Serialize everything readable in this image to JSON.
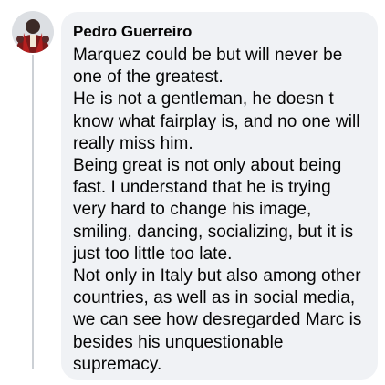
{
  "comment": {
    "author": "Pedro Guerreiro",
    "paragraphs": [
      "Marquez could be but will never be one of the greatest.",
      "He is not a gentleman, he doesn t know what fairplay is, and no one will really miss him.",
      "Being great is not only about being fast. I understand that he is trying very hard to change his image, smiling, dancing, socializing, but it is just too little too late.",
      "Not only in Italy but also among other countries, as well as in social media, we can see how desregarded Marc is besides his unquestionable supremacy."
    ]
  },
  "colors": {
    "bubble_bg": "#f0f2f5",
    "text": "#050505",
    "thread_line": "#ccd0d5"
  }
}
